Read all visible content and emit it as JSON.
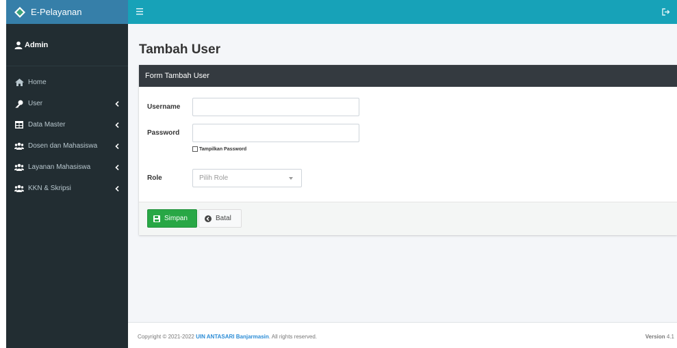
{
  "app": {
    "brand_name": "E-Pelayanan"
  },
  "sidebar": {
    "user_name": "Admin",
    "items": [
      {
        "label": "Home",
        "icon": "home-icon",
        "has_children": false
      },
      {
        "label": "User",
        "icon": "key-icon",
        "has_children": true
      },
      {
        "label": "Data Master",
        "icon": "table-icon",
        "has_children": true
      },
      {
        "label": "Dosen dan Mahasiswa",
        "icon": "users-icon",
        "has_children": true
      },
      {
        "label": "Layanan Mahasiswa",
        "icon": "users-icon",
        "has_children": true
      },
      {
        "label": "KKN & Skripsi",
        "icon": "users-icon",
        "has_children": true
      }
    ]
  },
  "topbar": {
    "menu_icon": "hamburger-icon",
    "logout_icon": "sign-out-icon"
  },
  "main": {
    "page_title": "Tambah User",
    "card_title": "Form Tambah User",
    "form": {
      "username_label": "Username",
      "username_value": "",
      "password_label": "Password",
      "password_value": "",
      "show_password_label": "Tampilkan Password",
      "show_password_checked": false,
      "role_label": "Role",
      "role_placeholder": "Pilih Role"
    },
    "actions": {
      "save_label": "Simpan",
      "cancel_label": "Batal"
    }
  },
  "footer": {
    "copyright_prefix": "Copyright © 2021-2022 ",
    "org": "UIN ANTASARI Banjarmasin",
    "rights": ". All rights reserved.",
    "version_label": "Version",
    "version": "4.1"
  },
  "colors": {
    "sidebar_bg": "#222d32",
    "brand_bg": "#367fa9",
    "topbar_bg": "#17a2b8",
    "card_header_bg": "#343a40",
    "save_button": "#28a745"
  }
}
